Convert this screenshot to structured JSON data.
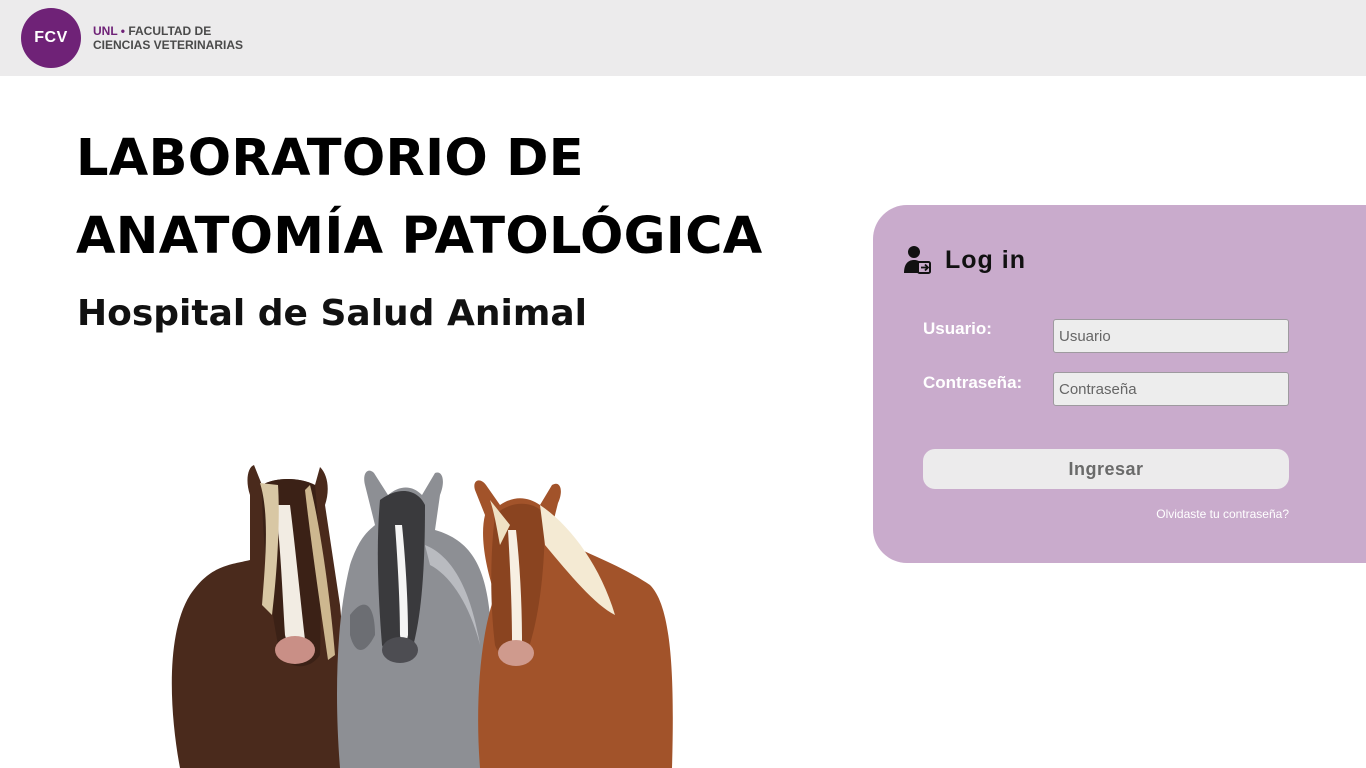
{
  "header": {
    "logo_initials": "FCV",
    "org_abbrev": "UNL",
    "org_separator": "•",
    "faculty_line1": "FACULTAD DE",
    "faculty_line2": "CIENCIAS VETERINARIAS"
  },
  "hero": {
    "title_line1": "LABORATORIO DE",
    "title_line2": "ANATOMÍA PATOLÓGICA",
    "subtitle": "Hospital de Salud Animal"
  },
  "login": {
    "title": "Log in",
    "icon": "user-login-icon",
    "username_label": "Usuario:",
    "username_placeholder": "Usuario",
    "password_label": "Contraseña:",
    "password_placeholder": "Contraseña",
    "submit_label": "Ingresar",
    "forgot_link": "Olvidaste tu contraseña?"
  },
  "colors": {
    "brand_purple": "#6f2277",
    "panel_lilac": "#c9abcc",
    "topbar_gray": "#ecebec"
  }
}
